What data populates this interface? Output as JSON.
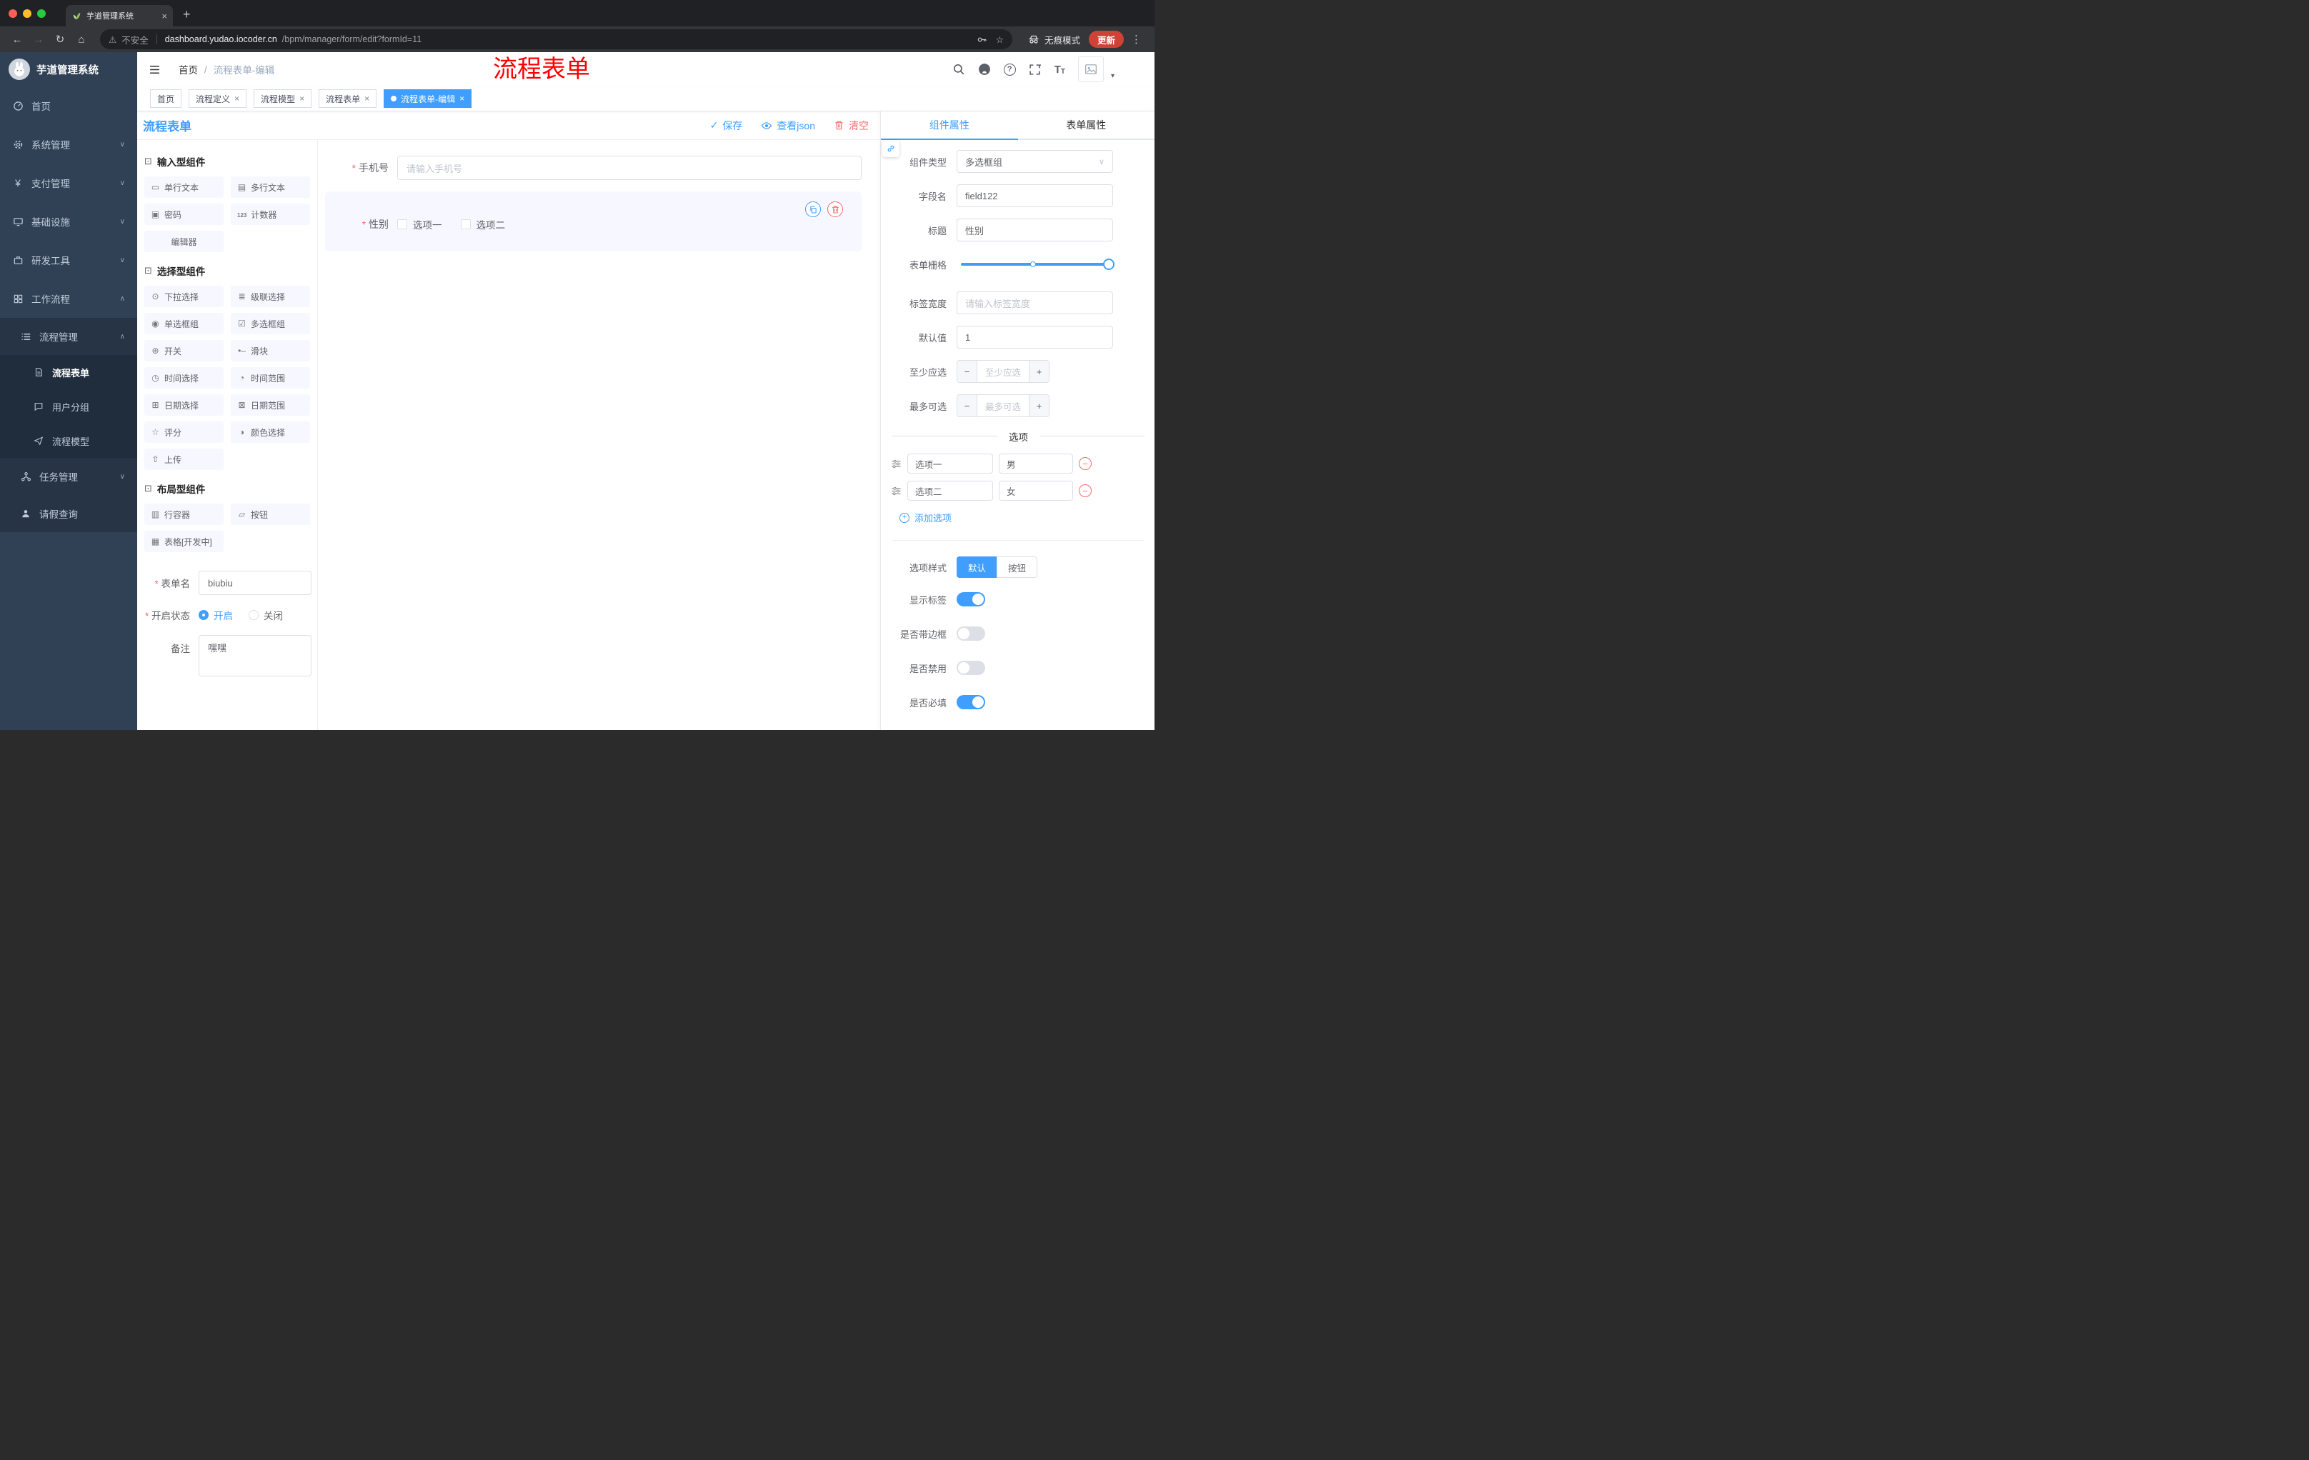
{
  "browser": {
    "tab_title": "芋道管理系统",
    "security_label": "不安全",
    "url_host": "dashboard.yudao.iocoder.cn",
    "url_path": "/bpm/manager/form/edit?formId=11",
    "incognito_label": "无痕模式",
    "update_label": "更新"
  },
  "sidebar": {
    "logo_title": "芋道管理系统",
    "items": [
      {
        "label": "首页"
      },
      {
        "label": "系统管理"
      },
      {
        "label": "支付管理"
      },
      {
        "label": "基础设施"
      },
      {
        "label": "研发工具"
      },
      {
        "label": "工作流程"
      }
    ],
    "submenu": {
      "process": {
        "label": "流程管理"
      },
      "children": [
        {
          "label": "流程表单",
          "active": true
        },
        {
          "label": "用户分组"
        },
        {
          "label": "流程模型"
        }
      ],
      "task": {
        "label": "任务管理"
      },
      "leave": {
        "label": "请假查询"
      }
    }
  },
  "header": {
    "breadcrumb": [
      "首页",
      "流程表单-编辑"
    ],
    "annotation": "流程表单"
  },
  "tags": [
    {
      "label": "首页",
      "closable": false,
      "active": false
    },
    {
      "label": "流程定义",
      "closable": true,
      "active": false
    },
    {
      "label": "流程模型",
      "closable": true,
      "active": false
    },
    {
      "label": "流程表单",
      "closable": true,
      "active": false
    },
    {
      "label": "流程表单-编辑",
      "closable": true,
      "active": true
    }
  ],
  "designer": {
    "title": "流程表单",
    "actions": {
      "save": "保存",
      "view_json": "查看json",
      "clear": "清空"
    },
    "palette": {
      "groups": [
        {
          "title": "输入型组件",
          "items": [
            "单行文本",
            "多行文本",
            "密码",
            "计数器",
            "编辑器"
          ]
        },
        {
          "title": "选择型组件",
          "items": [
            "下拉选择",
            "级联选择",
            "单选框组",
            "多选框组",
            "开关",
            "滑块",
            "时间选择",
            "时间范围",
            "日期选择",
            "日期范围",
            "评分",
            "颜色选择",
            "上传"
          ]
        },
        {
          "title": "布局型组件",
          "items": [
            "行容器",
            "按钮",
            "表格[开发中]"
          ]
        }
      ]
    },
    "form": {
      "name_label": "表单名",
      "name_value": "biubiu",
      "status_label": "开启状态",
      "status_on": "开启",
      "status_off": "关闭",
      "remark_label": "备注",
      "remark_value": "嘿嘿"
    },
    "canvas": {
      "phone": {
        "label": "手机号",
        "placeholder": "请输入手机号"
      },
      "gender": {
        "label": "性别",
        "options": [
          "选项一",
          "选项二"
        ]
      }
    }
  },
  "props": {
    "tab_component": "组件属性",
    "tab_form": "表单属性",
    "component_type_label": "组件类型",
    "component_type_value": "多选框组",
    "field_label": "字段名",
    "field_value": "field122",
    "title_label": "标题",
    "title_value": "性别",
    "grid_label": "表单栅格",
    "label_width_label": "标签宽度",
    "label_width_placeholder": "请输入标签宽度",
    "default_label": "默认值",
    "default_value": "1",
    "min_label": "至少应选",
    "min_placeholder": "至少应选",
    "max_label": "最多可选",
    "max_placeholder": "最多可选",
    "options_title": "选项",
    "options": [
      {
        "label": "选项一",
        "value": "男"
      },
      {
        "label": "选项二",
        "value": "女"
      }
    ],
    "add_option": "添加选项",
    "style_label": "选项样式",
    "style_default": "默认",
    "style_button": "按钮",
    "switch_show_label": "显示标签",
    "switch_border": "是否带边框",
    "switch_disabled": "是否禁用",
    "switch_required": "是否必填"
  },
  "colors": {
    "primary": "#409eff",
    "danger": "#f56c6c",
    "sidebar": "#304156",
    "annotation": "#ff0000"
  }
}
